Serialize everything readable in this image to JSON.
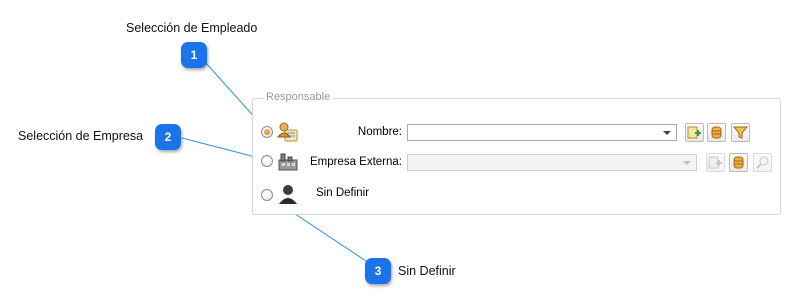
{
  "callouts": [
    {
      "number": "1",
      "text": "Selección de Empleado"
    },
    {
      "number": "2",
      "text": "Selección de Empresa"
    },
    {
      "number": "3",
      "text": "Sin Definir"
    }
  ],
  "panel": {
    "legend": "Responsable",
    "rows": [
      {
        "label": "Nombre:",
        "value": "",
        "selected": true,
        "enabled": true
      },
      {
        "label": "Empresa Externa:",
        "value": "",
        "selected": false,
        "enabled": false
      },
      {
        "label": "Sin Definir",
        "selected": false
      }
    ]
  },
  "colors": {
    "badge": "#1a73e8",
    "callout_line": "#2f8fde",
    "radio_checked": "#e66a00"
  },
  "icons": {
    "row1": "employee-icon",
    "row2": "company-building-icon",
    "row3": "person-silhouette-icon",
    "row1_buttons": [
      "add-employee-icon",
      "database-icon",
      "filter-icon"
    ],
    "row2_buttons": [
      "add-company-icon",
      "database-icon",
      "search-icon"
    ]
  }
}
